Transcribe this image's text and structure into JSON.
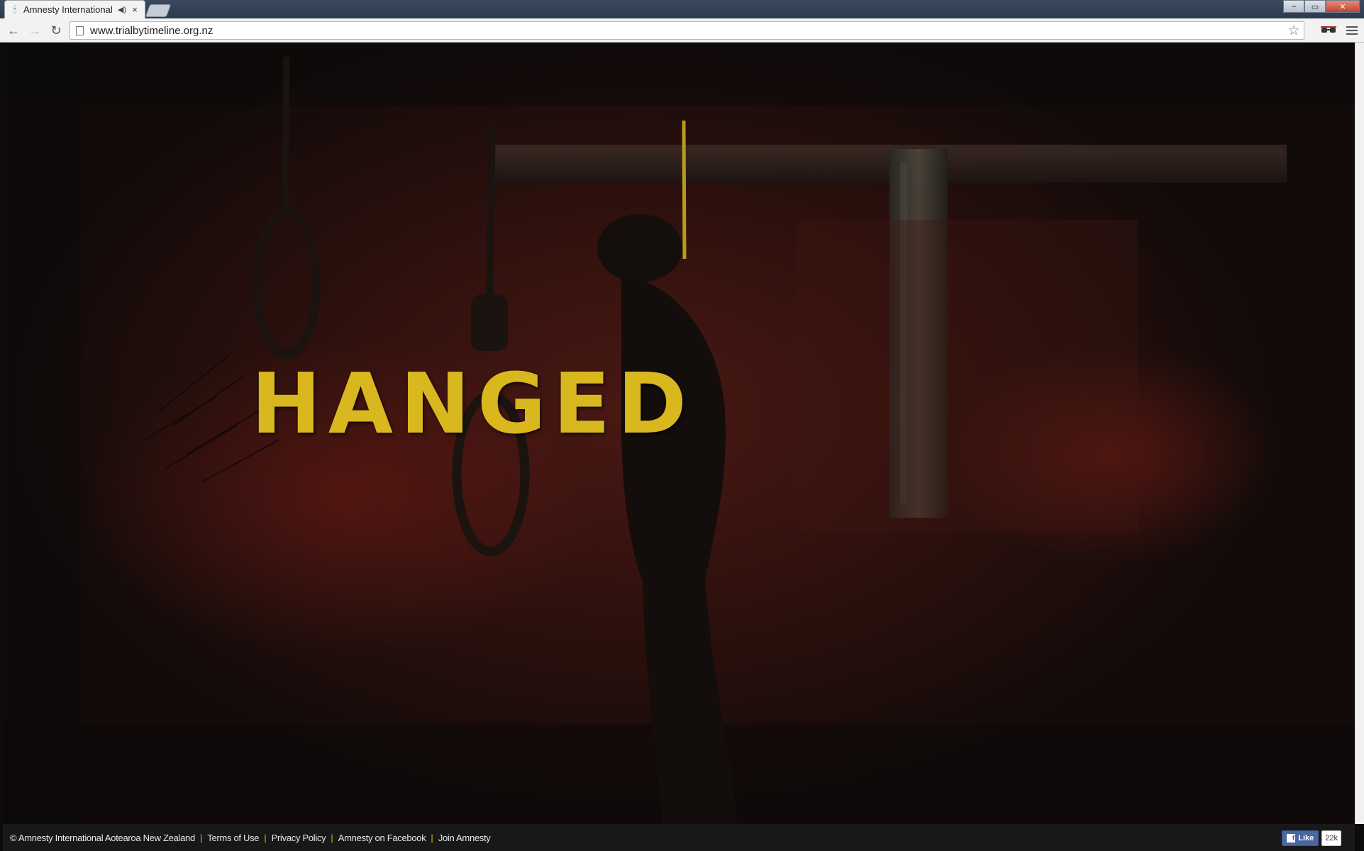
{
  "browser": {
    "tab": {
      "title": "Amnesty International",
      "favicon": "amnesty-candle-icon",
      "audio_icon": "speaker-icon",
      "close": "×"
    },
    "url": "www.trialbytimeline.org.nz",
    "icons": {
      "back": "←",
      "forward": "→",
      "reload": "↻",
      "star": "☆",
      "minimize": "–",
      "maximize": "▭",
      "close": "✕"
    }
  },
  "page": {
    "headline": "HANGED",
    "headline_color": "#d9b71e"
  },
  "footer": {
    "links": [
      "© Amnesty International Aotearoa New Zealand",
      "Terms of Use",
      "Privacy Policy",
      "Amnesty on Facebook",
      "Join Amnesty"
    ],
    "separator": "|",
    "facebook": {
      "like_label": "Like",
      "count": "22k"
    }
  }
}
